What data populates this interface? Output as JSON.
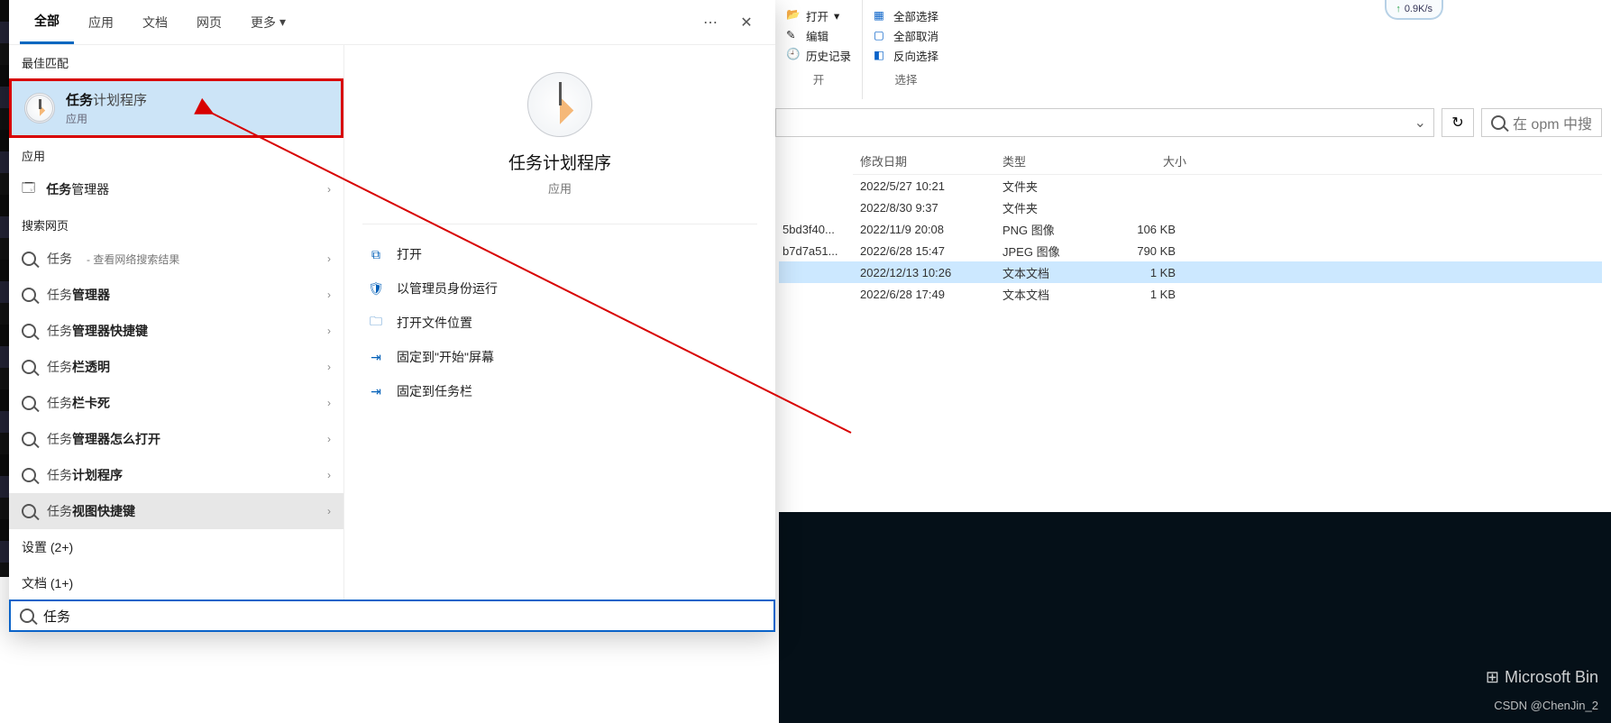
{
  "ribbon": {
    "open_label": "打开",
    "edit_label": "编辑",
    "history_label": "历史记录",
    "open_group": "开",
    "select_all": "全部选择",
    "deselect_all": "全部取消",
    "invert_select": "反向选择",
    "select_group": "选择"
  },
  "addressbar": {
    "refresh_tip": "刷新",
    "search_placeholder": "在 opm 中搜"
  },
  "columns": {
    "date": "修改日期",
    "type": "类型",
    "size": "大小"
  },
  "files": [
    {
      "name": "",
      "date": "2022/5/27 10:21",
      "type": "文件夹",
      "size": ""
    },
    {
      "name": "",
      "date": "2022/8/30 9:37",
      "type": "文件夹",
      "size": ""
    },
    {
      "name": "5bd3f40...",
      "date": "2022/11/9 20:08",
      "type": "PNG 图像",
      "size": "106 KB"
    },
    {
      "name": "b7d7a51...",
      "date": "2022/6/28 15:47",
      "type": "JPEG 图像",
      "size": "790 KB"
    },
    {
      "name": "",
      "date": "2022/12/13 10:26",
      "type": "文本文档",
      "size": "1 KB",
      "selected": true
    },
    {
      "name": "",
      "date": "2022/6/28 17:49",
      "type": "文本文档",
      "size": "1 KB"
    }
  ],
  "gauge": "0.9K/s",
  "brand": "Microsoft Bin",
  "credit": "CSDN @ChenJin_2",
  "search": {
    "tabs": {
      "all": "全部",
      "apps": "应用",
      "docs": "文档",
      "web": "网页",
      "more": "更多"
    },
    "sections": {
      "best_match": "最佳匹配",
      "apps": "应用",
      "web": "搜索网页",
      "settings": "设置 (2+)",
      "documents": "文档 (1+)"
    },
    "best": {
      "title_prefix": "任务",
      "title_rest": "计划程序",
      "sub": "应用"
    },
    "apps": [
      {
        "prefix": "任务",
        "rest": "管理器"
      }
    ],
    "web_hint": "- 查看网络搜索结果",
    "web": [
      {
        "prefix": "任务",
        "rest": ""
      },
      {
        "prefix": "任务",
        "rest": "管理器"
      },
      {
        "prefix": "任务",
        "rest": "管理器快捷键"
      },
      {
        "prefix": "任务",
        "rest": "栏透明"
      },
      {
        "prefix": "任务",
        "rest": "栏卡死"
      },
      {
        "prefix": "任务",
        "rest": "管理器怎么打开"
      },
      {
        "prefix": "任务",
        "rest": "计划程序"
      },
      {
        "prefix": "任务",
        "rest": "视图快捷键"
      }
    ],
    "preview": {
      "title": "任务计划程序",
      "sub": "应用"
    },
    "actions": {
      "open": "打开",
      "admin": "以管理员身份运行",
      "location": "打开文件位置",
      "pin_start": "固定到\"开始\"屏幕",
      "pin_taskbar": "固定到任务栏"
    },
    "query": "任务"
  }
}
